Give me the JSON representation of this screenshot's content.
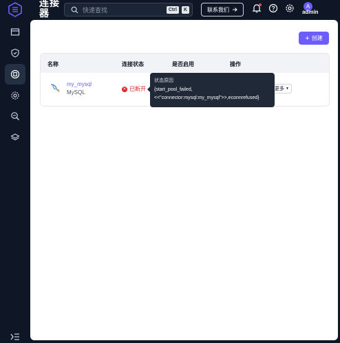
{
  "app": {
    "title": "连接器"
  },
  "search": {
    "placeholder": "快速查找",
    "shortcut_ctrl": "Ctrl",
    "shortcut_key": "K"
  },
  "header": {
    "contact_label": "联系我们",
    "username": "admin",
    "avatar_letter": "A"
  },
  "sidebar": {
    "items": [
      {
        "icon": "dashboard-icon"
      },
      {
        "icon": "shield-icon"
      },
      {
        "icon": "connector-icon",
        "active": true
      },
      {
        "icon": "settings-gear-icon"
      },
      {
        "icon": "search-zoom-icon"
      },
      {
        "icon": "layers-icon"
      }
    ]
  },
  "toolbar": {
    "create_label": "创建"
  },
  "table": {
    "headers": {
      "name": "名称",
      "status": "连接状态",
      "enabled": "是否启用",
      "actions": "操作"
    },
    "rows": [
      {
        "name": "my_mysql",
        "type": "MySQL",
        "status": "已断开",
        "more_label": "更多"
      }
    ]
  },
  "tooltip": {
    "title": "状态原因",
    "line1": "{start_pool_failed,",
    "line2": "<<\"connector:mysql:my_mysql\">>,econnrefused}"
  },
  "colors": {
    "accent": "#6d5dfc",
    "error": "#dc2626",
    "sidebar_bg": "#0f1726"
  }
}
